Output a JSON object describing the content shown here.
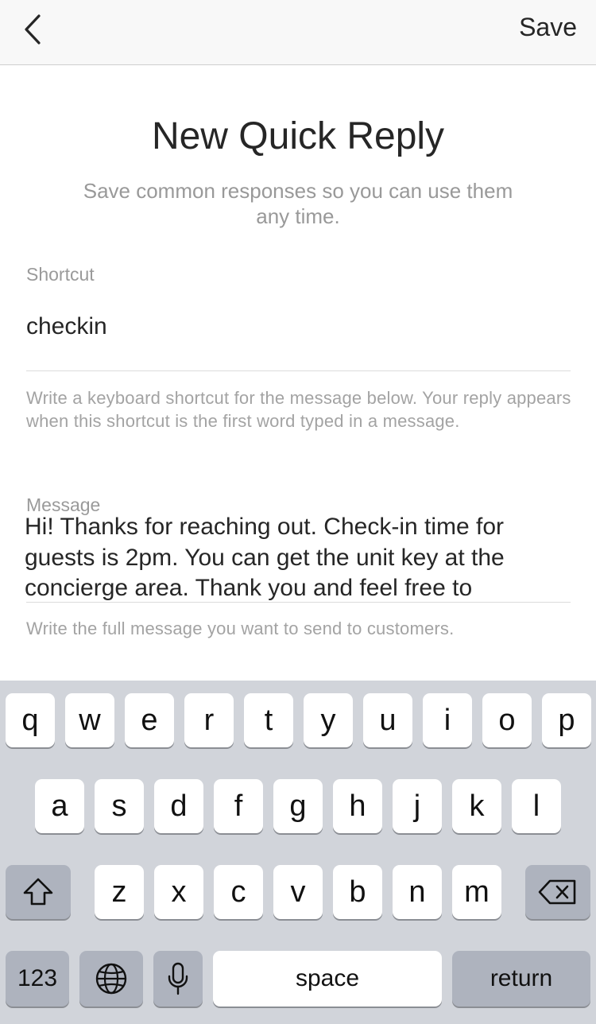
{
  "navbar": {
    "back_icon": "chevron-left-icon",
    "save_label": "Save"
  },
  "header": {
    "title": "New Quick Reply",
    "subtitle": "Save common responses so you can use them any time."
  },
  "shortcut": {
    "label": "Shortcut",
    "value": "checkin",
    "help": "Write a keyboard shortcut for the message below. Your reply appears when this shortcut is the first word typed in a message."
  },
  "message": {
    "label": "Message",
    "value": "Hi! Thanks for reaching out. Check-in time for guests is 2pm. You can get the unit key at the concierge area. Thank you and feel free to",
    "help": "Write the full message you want to send to customers."
  },
  "keyboard": {
    "row1": [
      "q",
      "w",
      "e",
      "r",
      "t",
      "y",
      "u",
      "i",
      "o",
      "p"
    ],
    "row2": [
      "a",
      "s",
      "d",
      "f",
      "g",
      "h",
      "j",
      "k",
      "l"
    ],
    "row3": [
      "z",
      "x",
      "c",
      "v",
      "b",
      "n",
      "m"
    ],
    "shift_icon": "shift-icon",
    "delete_icon": "delete-icon",
    "numbers_label": "123",
    "globe_icon": "globe-icon",
    "mic_icon": "microphone-icon",
    "space_label": "space",
    "return_label": "return"
  }
}
